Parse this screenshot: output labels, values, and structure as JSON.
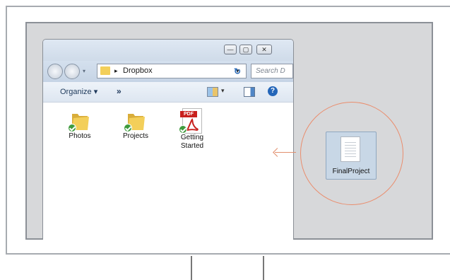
{
  "window": {
    "controls": {
      "minimize": "—",
      "maximize": "▢",
      "close": "✕"
    },
    "address": {
      "separator": "▸",
      "path": "Dropbox"
    },
    "search_placeholder": "Search D",
    "toolbar": {
      "organize": "Organize",
      "organize_caret": "▾",
      "more": "»"
    }
  },
  "items": [
    {
      "label": "Photos",
      "type": "folder",
      "synced": true
    },
    {
      "label": "Projects",
      "type": "folder",
      "synced": true
    },
    {
      "label": "Getting Started",
      "type": "pdf",
      "synced": true,
      "badge": "PDF"
    }
  ],
  "dragged_file": {
    "label": "FinalProject"
  },
  "colors": {
    "accent_circle": "#ea8d6d",
    "sync_check": "#3e9b3c",
    "pdf_red": "#c8201d",
    "folder_yellow": "#f3cf5a"
  },
  "icons": [
    "back-icon",
    "forward-icon",
    "folder-icon",
    "refresh-icon",
    "view-icon",
    "preview-pane-icon",
    "help-icon",
    "sync-check-icon",
    "pdf-icon",
    "document-icon",
    "arrow-left-icon"
  ]
}
